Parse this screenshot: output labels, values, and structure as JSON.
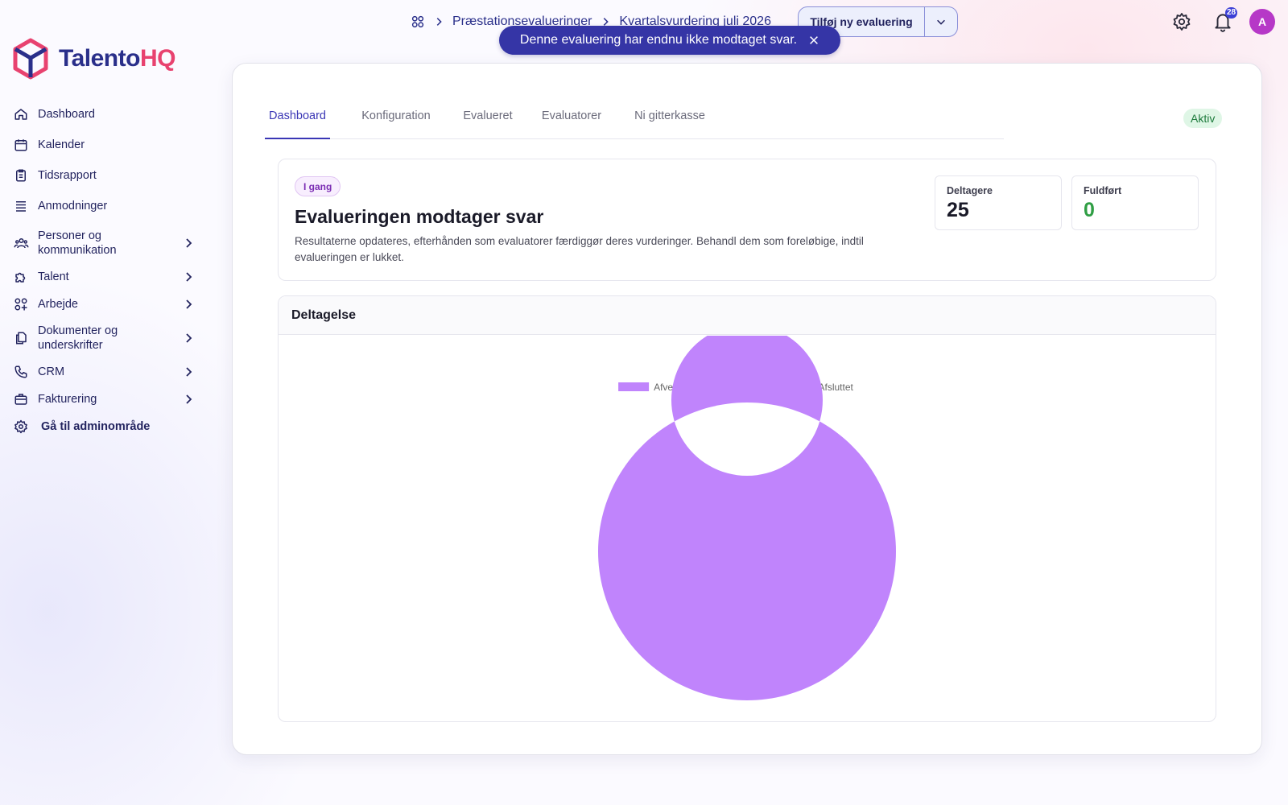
{
  "brand": {
    "name_part1": "Talento",
    "name_part2": "HQ"
  },
  "sidebar": {
    "items": [
      {
        "label": "Dashboard",
        "icon": "home-icon",
        "expandable": false
      },
      {
        "label": "Kalender",
        "icon": "calendar-icon",
        "expandable": false
      },
      {
        "label": "Tidsrapport",
        "icon": "clipboard-icon",
        "expandable": false
      },
      {
        "label": "Anmodninger",
        "icon": "list-icon",
        "expandable": false
      },
      {
        "label": "Personer og kommunikation",
        "icon": "people-icon",
        "expandable": true
      },
      {
        "label": "Talent",
        "icon": "puzzle-icon",
        "expandable": true
      },
      {
        "label": "Arbejde",
        "icon": "grid-plus-icon",
        "expandable": true
      },
      {
        "label": "Dokumenter og underskrifter",
        "icon": "documents-icon",
        "expandable": true
      },
      {
        "label": "CRM",
        "icon": "phone-icon",
        "expandable": true
      },
      {
        "label": "Fakturering",
        "icon": "briefcase-icon",
        "expandable": true
      }
    ],
    "admin_label": "Gå til adminområde"
  },
  "topbar": {
    "breadcrumbs": [
      "Præstationsevalueringer",
      "Kvartalsvurdering juli 2026"
    ],
    "add_button_label": "Tilføj ny evaluering",
    "notification_count": "28",
    "avatar_initial": "A"
  },
  "toast": {
    "message": "Denne evaluering har endnu ikke modtaget svar."
  },
  "tabs": [
    "Dashboard",
    "Konfiguration",
    "Evalueret",
    "Evaluatorer",
    "Ni gitterkasse"
  ],
  "active_tab": "Dashboard",
  "status": "Aktiv",
  "summary": {
    "badge": "I gang",
    "title": "Evalueringen modtager svar",
    "description": "Resultaterne opdateres, efterhånden som evaluatorer færdiggør deres vurderinger. Behandl dem som foreløbige, indtil evalueringen er lukket.",
    "stats": [
      {
        "label": "Deltagere",
        "value": "25"
      },
      {
        "label": "Fuldført",
        "value": "0"
      }
    ]
  },
  "participation": {
    "title": "Deltagelse"
  },
  "colors": {
    "accent": "#3a36b5",
    "brand_pink": "#e8426f",
    "brand_navy": "#2a2f8a"
  },
  "chart_data": {
    "type": "pie",
    "variant": "doughnut",
    "categories": [
      "Afventer",
      "I gang",
      "Afsluttet"
    ],
    "values": [
      25,
      0,
      0
    ],
    "colors": [
      "#c084fc",
      "#facc15",
      "#4ade80"
    ],
    "legend": "top"
  }
}
